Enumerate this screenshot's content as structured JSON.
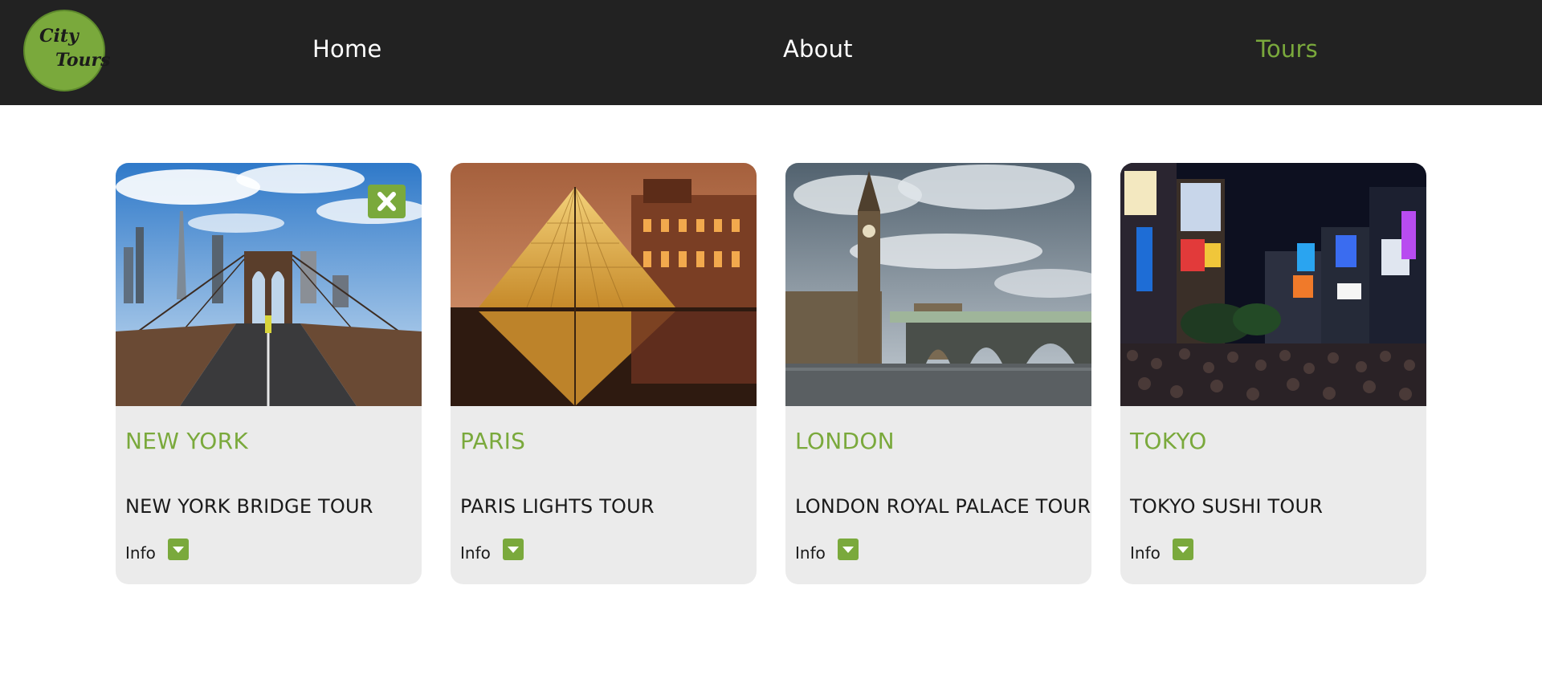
{
  "logo": {
    "line1": "City",
    "line2": "Tours"
  },
  "nav": {
    "home": "Home",
    "about": "About",
    "tours": "Tours"
  },
  "colors": {
    "accent": "#7aa93c",
    "navbar": "#222222",
    "card": "#ebebeb"
  },
  "tours": [
    {
      "city": "NEW YORK",
      "name": "NEW YORK BRIDGE TOUR",
      "info": "Info",
      "has_close": true,
      "image": "brooklyn-bridge-photo"
    },
    {
      "city": "PARIS",
      "name": "PARIS LIGHTS TOUR",
      "info": "Info",
      "has_close": false,
      "image": "louvre-pyramid-photo"
    },
    {
      "city": "LONDON",
      "name": "LONDON ROYAL PALACE TOUR",
      "info": "Info",
      "has_close": false,
      "image": "big-ben-photo"
    },
    {
      "city": "TOKYO",
      "name": "TOKYO SUSHI TOUR",
      "info": "Info",
      "has_close": false,
      "image": "shibuya-crossing-photo"
    }
  ]
}
